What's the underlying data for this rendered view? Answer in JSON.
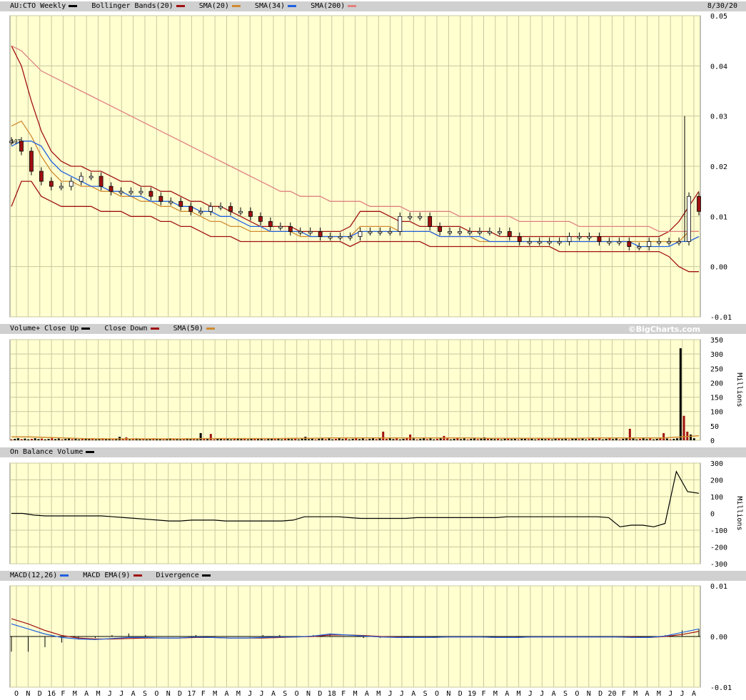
{
  "header": {
    "symbol_label": "AU:CTO Weekly",
    "date": "8/30/20",
    "legend_main": [
      {
        "label": "Bollinger Bands(20)",
        "color": "#a01010"
      },
      {
        "label": "SMA(20)",
        "color": "#d08a30"
      },
      {
        "label": "SMA(34)",
        "color": "#2060e0"
      },
      {
        "label": "SMA(200)",
        "color": "#e08080"
      }
    ]
  },
  "volume_header": {
    "legend": [
      {
        "label": "Volume+ Close Up",
        "color": "#000000"
      },
      {
        "label": "Close Down",
        "color": "#a01010"
      },
      {
        "label": "SMA(50)",
        "color": "#d08a30"
      }
    ],
    "credit": "©BigCharts.com",
    "units": "Millions"
  },
  "obv_header": {
    "label": "On Balance Volume",
    "color": "#000000",
    "units": "Millions"
  },
  "macd_header": {
    "legend": [
      {
        "label": "MACD(12,26)",
        "color": "#2060e0"
      },
      {
        "label": "MACD EMA(9)",
        "color": "#a01010"
      },
      {
        "label": "Divergence",
        "color": "#000000"
      }
    ]
  },
  "x_labels": [
    "O",
    "N",
    "D",
    "16",
    "F",
    "M",
    "A",
    "M",
    "J",
    "J",
    "A",
    "S",
    "O",
    "N",
    "D",
    "17",
    "F",
    "M",
    "A",
    "M",
    "J",
    "J",
    "A",
    "S",
    "O",
    "N",
    "D",
    "18",
    "F",
    "M",
    "A",
    "M",
    "J",
    "J",
    "A",
    "S",
    "O",
    "N",
    "D",
    "19",
    "F",
    "M",
    "A",
    "M",
    "J",
    "J",
    "A",
    "S",
    "O",
    "N",
    "D",
    "20",
    "F",
    "M",
    "A",
    "M",
    "J",
    "J",
    "A"
  ],
  "chart_data": [
    {
      "type": "line",
      "panel": "price",
      "title": "AU:CTO Weekly",
      "ylim": [
        -0.01,
        0.05
      ],
      "y_ticks": [
        "0.05",
        "0.04",
        "0.03",
        "0.02",
        "0.01",
        "0.00",
        "-0.01"
      ],
      "annotation": "10T",
      "grid": true,
      "series": [
        {
          "name": "Price (close)",
          "values": [
            0.025,
            0.023,
            0.019,
            0.017,
            0.016,
            0.016,
            0.017,
            0.018,
            0.018,
            0.016,
            0.015,
            0.015,
            0.015,
            0.015,
            0.014,
            0.013,
            0.013,
            0.012,
            0.011,
            0.011,
            0.012,
            0.012,
            0.011,
            0.011,
            0.01,
            0.009,
            0.008,
            0.008,
            0.007,
            0.007,
            0.007,
            0.006,
            0.006,
            0.006,
            0.006,
            0.007,
            0.007,
            0.007,
            0.007,
            0.01,
            0.01,
            0.01,
            0.008,
            0.007,
            0.007,
            0.007,
            0.007,
            0.007,
            0.007,
            0.007,
            0.006,
            0.005,
            0.005,
            0.005,
            0.005,
            0.005,
            0.006,
            0.006,
            0.006,
            0.005,
            0.005,
            0.005,
            0.004,
            0.004,
            0.005,
            0.005,
            0.005,
            0.005,
            0.014,
            0.011
          ]
        },
        {
          "name": "Bollinger Bands(20) upper",
          "values": [
            0.044,
            0.04,
            0.033,
            0.027,
            0.023,
            0.021,
            0.02,
            0.02,
            0.019,
            0.019,
            0.018,
            0.017,
            0.017,
            0.016,
            0.016,
            0.015,
            0.015,
            0.014,
            0.013,
            0.013,
            0.012,
            0.012,
            0.011,
            0.01,
            0.009,
            0.008,
            0.008,
            0.008,
            0.008,
            0.007,
            0.007,
            0.007,
            0.007,
            0.007,
            0.008,
            0.011,
            0.011,
            0.011,
            0.01,
            0.009,
            0.009,
            0.008,
            0.008,
            0.008,
            0.008,
            0.008,
            0.007,
            0.007,
            0.007,
            0.006,
            0.006,
            0.006,
            0.006,
            0.006,
            0.006,
            0.006,
            0.006,
            0.006,
            0.006,
            0.006,
            0.006,
            0.006,
            0.006,
            0.006,
            0.006,
            0.006,
            0.007,
            0.009,
            0.012,
            0.015
          ]
        },
        {
          "name": "Bollinger Bands(20) lower",
          "values": [
            0.012,
            0.017,
            0.017,
            0.014,
            0.013,
            0.012,
            0.012,
            0.012,
            0.012,
            0.011,
            0.011,
            0.011,
            0.01,
            0.01,
            0.01,
            0.009,
            0.009,
            0.008,
            0.008,
            0.007,
            0.006,
            0.006,
            0.006,
            0.005,
            0.005,
            0.005,
            0.005,
            0.005,
            0.005,
            0.005,
            0.005,
            0.005,
            0.005,
            0.005,
            0.004,
            0.005,
            0.005,
            0.005,
            0.005,
            0.005,
            0.005,
            0.005,
            0.004,
            0.004,
            0.004,
            0.004,
            0.004,
            0.004,
            0.004,
            0.004,
            0.004,
            0.004,
            0.004,
            0.004,
            0.004,
            0.003,
            0.003,
            0.003,
            0.003,
            0.003,
            0.003,
            0.003,
            0.003,
            0.003,
            0.003,
            0.003,
            0.002,
            0.0,
            -0.001,
            -0.001
          ]
        },
        {
          "name": "SMA(20)",
          "values": [
            0.028,
            0.029,
            0.026,
            0.022,
            0.019,
            0.017,
            0.017,
            0.016,
            0.016,
            0.015,
            0.015,
            0.014,
            0.014,
            0.013,
            0.013,
            0.012,
            0.012,
            0.011,
            0.011,
            0.01,
            0.009,
            0.009,
            0.008,
            0.008,
            0.007,
            0.007,
            0.007,
            0.007,
            0.007,
            0.006,
            0.006,
            0.006,
            0.006,
            0.006,
            0.006,
            0.008,
            0.008,
            0.008,
            0.008,
            0.007,
            0.007,
            0.007,
            0.007,
            0.006,
            0.006,
            0.006,
            0.006,
            0.005,
            0.005,
            0.005,
            0.005,
            0.005,
            0.005,
            0.005,
            0.005,
            0.005,
            0.005,
            0.005,
            0.005,
            0.005,
            0.005,
            0.005,
            0.005,
            0.005,
            0.005,
            0.005,
            0.005,
            0.005,
            0.007,
            0.007
          ]
        },
        {
          "name": "SMA(34)",
          "values": [
            0.024,
            0.025,
            0.025,
            0.024,
            0.021,
            0.019,
            0.018,
            0.017,
            0.016,
            0.016,
            0.015,
            0.015,
            0.014,
            0.014,
            0.013,
            0.013,
            0.013,
            0.012,
            0.012,
            0.011,
            0.011,
            0.01,
            0.01,
            0.009,
            0.008,
            0.008,
            0.007,
            0.007,
            0.007,
            0.007,
            0.006,
            0.006,
            0.006,
            0.006,
            0.006,
            0.007,
            0.007,
            0.007,
            0.007,
            0.007,
            0.007,
            0.007,
            0.007,
            0.006,
            0.006,
            0.006,
            0.006,
            0.006,
            0.005,
            0.005,
            0.005,
            0.005,
            0.005,
            0.005,
            0.005,
            0.005,
            0.005,
            0.005,
            0.005,
            0.005,
            0.005,
            0.005,
            0.005,
            0.004,
            0.004,
            0.004,
            0.004,
            0.005,
            0.005,
            0.006
          ]
        },
        {
          "name": "SMA(200)",
          "values": [
            0.044,
            0.043,
            0.041,
            0.039,
            0.038,
            0.037,
            0.036,
            0.035,
            0.034,
            0.033,
            0.032,
            0.031,
            0.03,
            0.029,
            0.028,
            0.027,
            0.026,
            0.025,
            0.024,
            0.023,
            0.022,
            0.021,
            0.02,
            0.019,
            0.018,
            0.017,
            0.016,
            0.015,
            0.015,
            0.014,
            0.014,
            0.014,
            0.013,
            0.013,
            0.013,
            0.013,
            0.012,
            0.012,
            0.012,
            0.012,
            0.011,
            0.011,
            0.011,
            0.011,
            0.011,
            0.01,
            0.01,
            0.01,
            0.01,
            0.01,
            0.01,
            0.009,
            0.009,
            0.009,
            0.009,
            0.009,
            0.009,
            0.008,
            0.008,
            0.008,
            0.008,
            0.008,
            0.008,
            0.008,
            0.008,
            0.007,
            0.007,
            0.007,
            0.007,
            0.007
          ]
        }
      ]
    },
    {
      "type": "bar",
      "panel": "volume",
      "ylim": [
        0,
        350
      ],
      "y_ticks": [
        "350",
        "300",
        "250",
        "200",
        "150",
        "100",
        "50",
        "0"
      ],
      "ylabel": "Millions",
      "spikes": [
        {
          "week": 32,
          "value": 12,
          "up": true
        },
        {
          "week": 34,
          "value": 10,
          "up": false
        },
        {
          "week": 56,
          "value": 25,
          "up": true
        },
        {
          "week": 59,
          "value": 22,
          "up": false
        },
        {
          "week": 87,
          "value": 12,
          "up": true
        },
        {
          "week": 110,
          "value": 30,
          "up": false
        },
        {
          "week": 118,
          "value": 20,
          "up": false
        },
        {
          "week": 128,
          "value": 15,
          "up": false
        },
        {
          "week": 140,
          "value": 10,
          "up": true
        },
        {
          "week": 183,
          "value": 40,
          "up": false
        },
        {
          "week": 193,
          "value": 25,
          "up": false
        },
        {
          "week": 198,
          "value": 320,
          "up": true
        },
        {
          "week": 199,
          "value": 85,
          "up": false
        },
        {
          "week": 200,
          "value": 30,
          "up": false
        },
        {
          "week": 201,
          "value": 20,
          "up": true
        }
      ],
      "sma50": [
        12,
        12,
        10,
        8,
        6,
        5,
        5,
        5,
        5,
        5,
        5,
        6,
        6,
        6,
        6,
        6,
        7,
        7,
        8,
        8,
        8,
        8,
        8,
        8,
        8,
        8,
        8,
        7,
        7,
        7,
        7,
        7,
        7,
        8,
        8,
        8,
        8,
        8,
        12,
        16
      ]
    },
    {
      "type": "line",
      "panel": "obv",
      "ylim": [
        -300,
        300
      ],
      "y_ticks": [
        "300",
        "200",
        "100",
        "0",
        "-100",
        "-200",
        "-300"
      ],
      "ylabel": "Millions",
      "series": [
        {
          "name": "On Balance Volume",
          "values": [
            0,
            0,
            -10,
            -15,
            -15,
            -15,
            -15,
            -15,
            -15,
            -20,
            -25,
            -30,
            -35,
            -40,
            -45,
            -45,
            -40,
            -40,
            -40,
            -45,
            -45,
            -45,
            -45,
            -45,
            -45,
            -40,
            -20,
            -20,
            -20,
            -20,
            -25,
            -30,
            -30,
            -30,
            -30,
            -30,
            -25,
            -25,
            -25,
            -25,
            -25,
            -25,
            -25,
            -25,
            -20,
            -20,
            -20,
            -20,
            -20,
            -20,
            -20,
            -20,
            -20,
            -25,
            -80,
            -70,
            -70,
            -80,
            -60,
            250,
            130,
            120
          ]
        }
      ]
    },
    {
      "type": "line",
      "panel": "macd",
      "ylim": [
        -0.01,
        0.01
      ],
      "y_ticks": [
        "0.01",
        "0.00",
        "-0.01"
      ],
      "series": [
        {
          "name": "MACD(12,26)",
          "values": [
            0.0025,
            0.0015,
            0.0005,
            -0.0002,
            -0.0005,
            -0.0006,
            -0.0004,
            -0.0002,
            -0.0002,
            -0.0003,
            -0.0003,
            -0.0001,
            -0.0002,
            -0.0003,
            -0.0003,
            -0.0002,
            -0.0001,
            -0.0001,
            0.0001,
            0.0005,
            0.0003,
            0.0001,
            -0.0001,
            -0.0002,
            -0.0002,
            -0.0002,
            -0.0001,
            -0.0001,
            -0.0001,
            -0.0002,
            -0.0002,
            -0.0001,
            -0.0001,
            -0.0001,
            -0.0001,
            -0.0001,
            -0.0001,
            -0.0002,
            -0.0002,
            0.0001,
            0.0008,
            0.0015
          ]
        },
        {
          "name": "MACD EMA(9)",
          "values": [
            0.0035,
            0.0025,
            0.0012,
            0.0002,
            -0.0003,
            -0.0005,
            -0.0005,
            -0.0004,
            -0.0003,
            -0.0003,
            -0.0003,
            -0.0002,
            -0.0002,
            -0.0003,
            -0.0003,
            -0.0003,
            -0.0002,
            -0.0001,
            0.0,
            0.0003,
            0.0003,
            0.0002,
            0.0,
            -0.0001,
            -0.0002,
            -0.0002,
            -0.0001,
            -0.0001,
            -0.0001,
            -0.0002,
            -0.0002,
            -0.0001,
            -0.0001,
            -0.0001,
            -0.0001,
            -0.0001,
            -0.0001,
            -0.0001,
            -0.0002,
            0.0,
            0.0004,
            0.001
          ]
        }
      ]
    }
  ]
}
